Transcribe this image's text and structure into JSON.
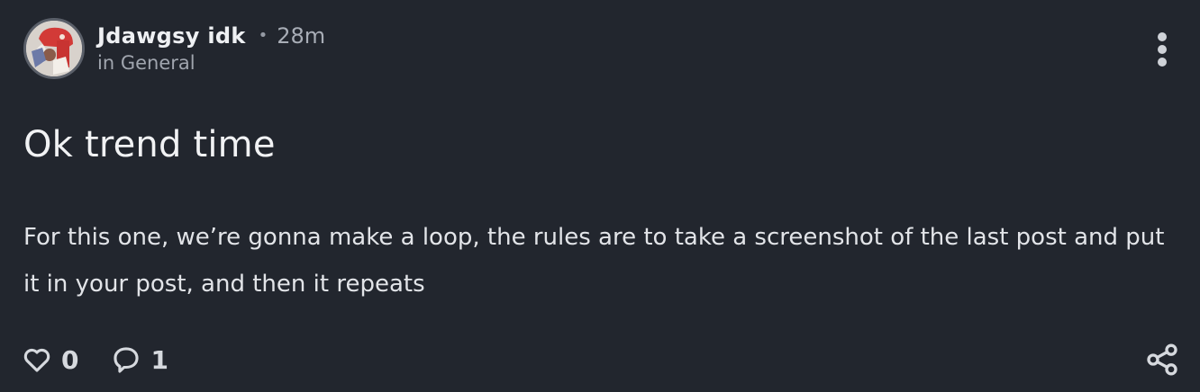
{
  "post": {
    "author": "Jdawgsy idk",
    "separator": "•",
    "timestamp": "28m",
    "community": "in General",
    "title": "Ok trend time",
    "body": "For this one, we’re gonna make a loop, the rules are to take a screenshot of the last post and put it in your post, and then it repeats",
    "likes": "0",
    "comments": "1"
  },
  "icons": {
    "more": "more-vertical-icon",
    "like": "heart-icon",
    "comment": "comment-icon",
    "share": "share-icon"
  },
  "colors": {
    "background": "#22262e",
    "text": "#e6e8ec",
    "muted": "#a0a5ae"
  }
}
